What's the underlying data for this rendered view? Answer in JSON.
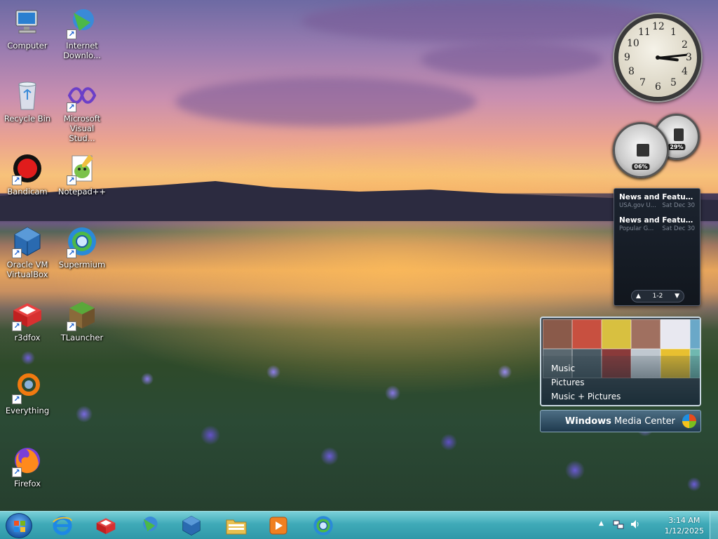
{
  "desktop": {
    "icons": [
      {
        "label": "Computer",
        "icon": "computer-icon",
        "shortcut": false
      },
      {
        "label": "Internet Downlo...",
        "icon": "internet-download-manager-icon",
        "shortcut": true
      },
      {
        "label": "Recycle Bin",
        "icon": "recycle-bin-icon",
        "shortcut": false
      },
      {
        "label": "Microsoft Visual Stud...",
        "icon": "visual-studio-icon",
        "shortcut": true
      },
      {
        "label": "Bandicam",
        "icon": "bandicam-icon",
        "shortcut": true
      },
      {
        "label": "Notepad++",
        "icon": "notepad-plus-plus-icon",
        "shortcut": true
      },
      {
        "label": "Oracle VM VirtualBox",
        "icon": "virtualbox-icon",
        "shortcut": true
      },
      {
        "label": "Supermium",
        "icon": "supermium-icon",
        "shortcut": true
      },
      {
        "label": "r3dfox",
        "icon": "r3dfox-icon",
        "shortcut": true
      },
      {
        "label": "TLauncher",
        "icon": "tlauncher-icon",
        "shortcut": true
      },
      {
        "label": "Everything",
        "icon": "everything-search-icon",
        "shortcut": true
      },
      {
        "label": "Firefox",
        "icon": "firefox-icon",
        "shortcut": true
      }
    ]
  },
  "gadgets": {
    "clock": {
      "numerals": [
        "12",
        "1",
        "2",
        "3",
        "4",
        "5",
        "6",
        "7",
        "8",
        "9",
        "10",
        "11"
      ],
      "time": "3:14"
    },
    "cpu_meter": {
      "cpu_percent": 6,
      "cpu_label": "06%",
      "memory_percent": 29,
      "memory_label": "29%"
    },
    "feed_headlines": {
      "items": [
        {
          "title": "News and Features f...",
          "source": "USA.gov U...",
          "date": "Sat Dec 30"
        },
        {
          "title": "News and Feature...",
          "source": "Popular G...",
          "date": "Sat Dec 30"
        }
      ],
      "page": "1-2"
    },
    "media_center": {
      "menu": [
        "Music",
        "Pictures",
        "Music + Pictures"
      ],
      "brand_bold": "Windows",
      "brand_rest": " Media Center"
    }
  },
  "taskbar": {
    "pinned": [
      {
        "name": "internet-explorer-icon"
      },
      {
        "name": "r3dfox-icon"
      },
      {
        "name": "internet-download-manager-icon"
      },
      {
        "name": "virtualbox-icon"
      },
      {
        "name": "file-explorer-icon"
      },
      {
        "name": "media-player-icon"
      },
      {
        "name": "supermium-icon"
      }
    ],
    "tray": {
      "time": "3:14 AM",
      "date": "1/12/2025"
    }
  },
  "colors": {
    "taskbar": "#3faab8",
    "feed_bg": "#11161d",
    "accent": "#1e8fe0"
  }
}
